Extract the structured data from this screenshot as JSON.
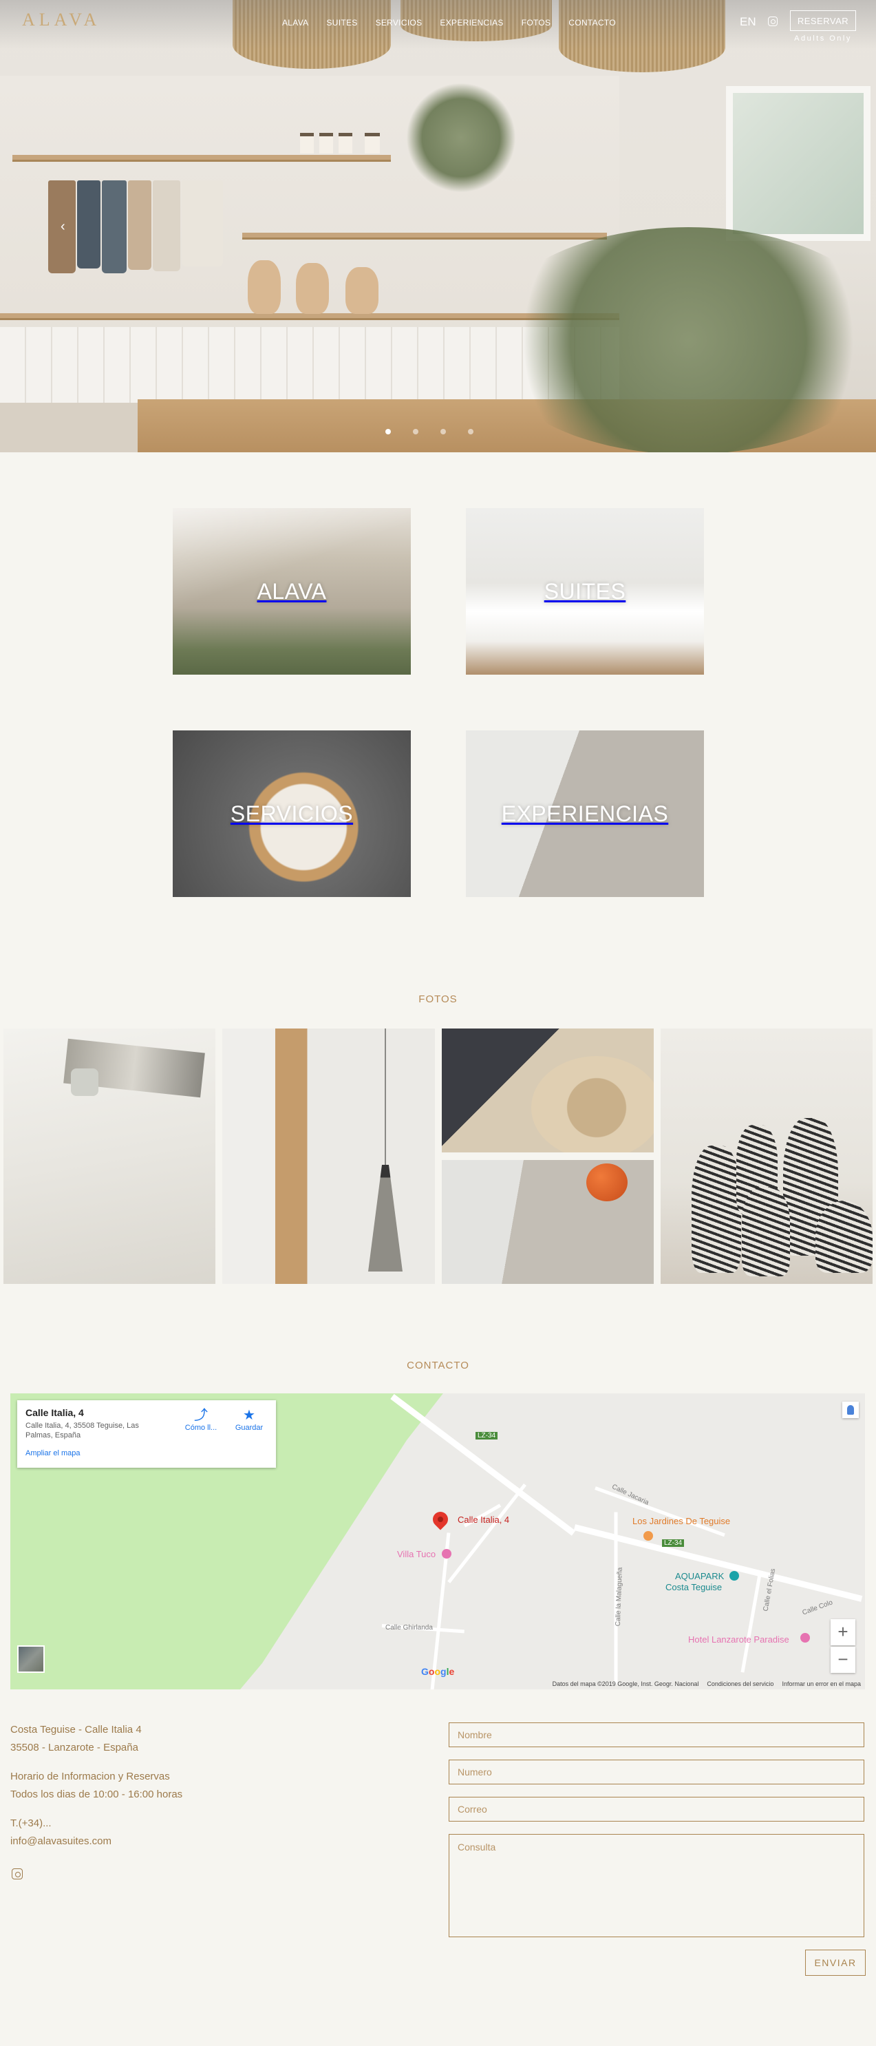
{
  "header": {
    "logo": "ALAVA",
    "nav": [
      "ALAVA",
      "SUITES",
      "SERVICIOS",
      "EXPERIENCIAS",
      "FOTOS",
      "CONTACTO"
    ],
    "lang": "EN",
    "reservar": "RESERVAR",
    "adults_only": "Adults Only"
  },
  "tiles": {
    "alava": "ALAVA",
    "suites": "SUITES",
    "servicios": "SERVICIOS",
    "experiencias": "EXPERIENCIAS"
  },
  "sections": {
    "fotos": "FOTOS",
    "contacto": "CONTACTO"
  },
  "map": {
    "card_title": "Calle Italia, 4",
    "card_address": "Calle Italia, 4, 35508 Teguise, Las Palmas, España",
    "card_directions": "Cómo ll...",
    "card_save": "Guardar",
    "card_enlarge": "Ampliar el mapa",
    "pin_label": "Calle Italia, 4",
    "labels": {
      "jardines": "Los Jardines De Teguise",
      "villa_tuco": "Villa Tuco",
      "aquapark": "AQUAPARK",
      "costa_teguise": "Costa Teguise",
      "hotel_paradise": "Hotel Lanzarote Paradise",
      "lz34_a": "LZ-34",
      "lz34_b": "LZ-34",
      "calle_jacaria": "Calle Jacaria",
      "calle_malagueña": "Calle la Malagueña",
      "calle_ghirlanda": "Calle Ghirlanda",
      "calle_folias": "Calle el Folias",
      "calle_lzcola": "Calle Colo"
    },
    "google": "Google",
    "footer": [
      "Datos del mapa ©2019 Google, Inst. Geogr. Nacional",
      "Condiciones del servicio",
      "Informar un error en el mapa"
    ]
  },
  "contact": {
    "address_line1": "Costa Teguise - Calle Italia 4",
    "address_line2": "35508 - Lanzarote - España",
    "hours_line1": "Horario de Informacion y Reservas",
    "hours_line2": "Todos los dias de 10:00 - 16:00 horas",
    "phone": "T.(+34)...",
    "email": "info@alavasuites.com"
  },
  "form": {
    "nombre_placeholder": "Nombre",
    "numero_placeholder": "Numero",
    "correo_placeholder": "Correo",
    "consulta_placeholder": "Consulta",
    "submit": "ENVIAR"
  },
  "colors": {
    "background": "#f6f5f0",
    "accent": "#a9844f",
    "logo": "#c9a978"
  },
  "icons": [
    "instagram-icon",
    "chevron-left-icon",
    "map-pin-icon",
    "directions-icon",
    "star-icon",
    "pegman-icon",
    "zoom-in-icon",
    "zoom-out-icon"
  ]
}
